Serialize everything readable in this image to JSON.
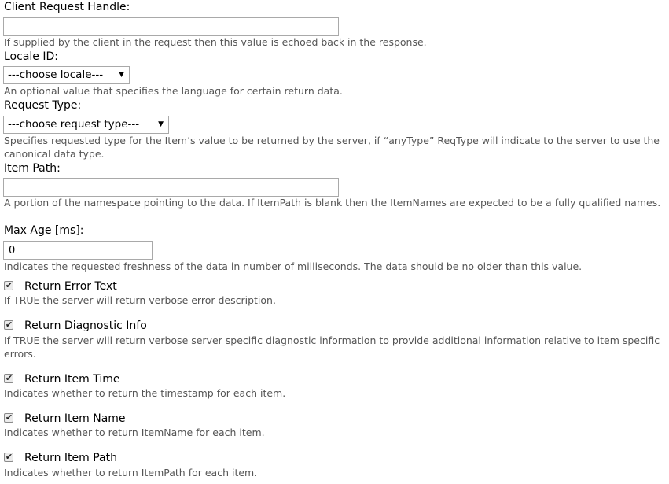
{
  "client_request_handle": {
    "label": "Client Request Handle:",
    "value": "",
    "help": "If supplied by the client in the request then this value is echoed back in the response."
  },
  "locale_id": {
    "label": "Locale ID:",
    "selected": "---choose locale---",
    "help": "An optional value that specifies the language for certain return data."
  },
  "request_type": {
    "label": "Request Type:",
    "selected": "---choose request type---",
    "help": "Specifies requested type for the Item’s value to be returned by the server, if “anyType” ReqType will indicate to the server to use the canonical data type."
  },
  "item_path": {
    "label": "Item Path:",
    "value": "",
    "help": "A portion of the namespace pointing to the data. If ItemPath is blank then the ItemNames are expected to be a fully qualified names."
  },
  "max_age": {
    "label": "Max Age [ms]:",
    "value": "0",
    "help": "Indicates the requested freshness of the data in number of milliseconds. The data should be no older than this value."
  },
  "checkboxes": [
    {
      "label": "Return Error Text",
      "checked": true,
      "help": "If TRUE the server will return verbose error description."
    },
    {
      "label": "Return Diagnostic Info",
      "checked": true,
      "help": "If TRUE the server will return verbose server specific diagnostic information to provide additional information relative to item specific errors."
    },
    {
      "label": "Return Item Time",
      "checked": true,
      "help": "Indicates whether to return the timestamp for each item."
    },
    {
      "label": "Return Item Name",
      "checked": true,
      "help": "Indicates whether to return ItemName for each item."
    },
    {
      "label": "Return Item Path",
      "checked": true,
      "help": "Indicates whether to return ItemPath for each item."
    }
  ],
  "check_glyph": "✔"
}
